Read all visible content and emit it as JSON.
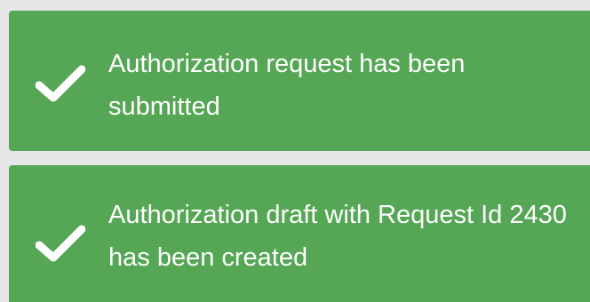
{
  "notifications": [
    {
      "icon": "checkmark-icon",
      "message": "Authorization request has been submitted",
      "status": "success"
    },
    {
      "icon": "checkmark-icon",
      "message": "Authorization draft with Request Id 2430 has been created",
      "status": "success"
    }
  ],
  "colors": {
    "success_bg": "#55a655",
    "text": "#ffffff",
    "page_bg": "#e6e6e6"
  }
}
